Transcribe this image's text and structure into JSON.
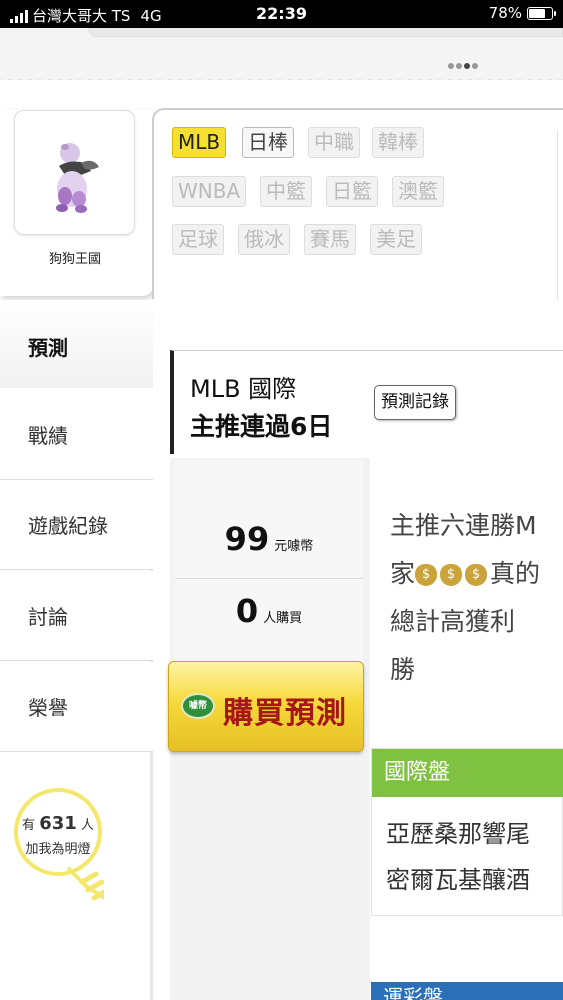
{
  "status_bar": {
    "carrier": "台灣大哥大 TS",
    "network": "4G",
    "time": "22:39",
    "battery": "78%",
    "battery_level": 0.78
  },
  "profile": {
    "name": "狗狗王國"
  },
  "sports": {
    "row1": [
      "MLB",
      "日棒",
      "中職",
      "韓棒"
    ],
    "row2": [
      "WNBA",
      "中籃",
      "日籃",
      "澳籃"
    ],
    "row3": [
      "足球",
      "俄冰",
      "賽馬",
      "美足"
    ],
    "active": "MLB"
  },
  "nav": {
    "items": [
      "預測",
      "戰績",
      "遊戲紀錄",
      "討論",
      "榮譽"
    ]
  },
  "bulb": {
    "prefix": "有",
    "count": "631",
    "suffix": "人",
    "line2": "加我為明燈"
  },
  "prediction": {
    "league": "MLB 國際",
    "streak": "主推連過6日",
    "records_button": "預測記錄"
  },
  "price": {
    "amount": "99",
    "unit": "元噱幣",
    "buyers": "0",
    "buyers_unit": "人購買",
    "buy_button": "購買預測",
    "coin_label": "噱幣"
  },
  "description": {
    "line1": "主推六連勝M",
    "line2_a": "家",
    "line2_b": "真的",
    "line3": "總計高獲利",
    "line4": "勝",
    "money_icon": "money-bag-icon"
  },
  "international": {
    "title": "國際盤",
    "line1": "亞歷桑那響尾",
    "line2": "密爾瓦基釀酒"
  },
  "lottery": {
    "title": "運彩盤"
  },
  "colors": {
    "active_tag": "#f6df33",
    "intl_header": "#7fc241",
    "lottery_header": "#2a6fb8",
    "buy_text": "#a51616"
  }
}
